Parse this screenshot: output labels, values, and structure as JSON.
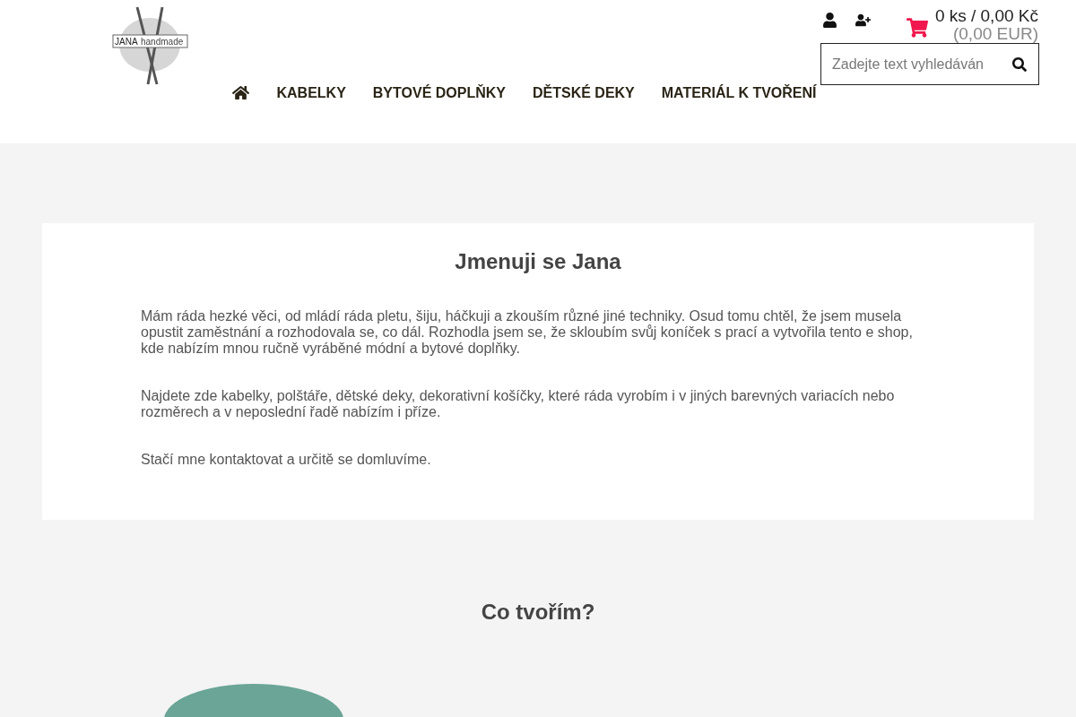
{
  "logo": {
    "name": "JANA",
    "suffix": "handmade"
  },
  "cart": {
    "summary": "0 ks / 0,00 Kč",
    "eur": "(0,00 EUR)"
  },
  "search": {
    "placeholder": "Zadejte text vyhledáván"
  },
  "nav": [
    {
      "kind": "home"
    },
    {
      "label": "KABELKY"
    },
    {
      "label": "BYTOVÉ DOPLŇKY"
    },
    {
      "label": "DĚTSKÉ DEKY"
    },
    {
      "label": "MATERIÁL K TVOŘENÍ"
    }
  ],
  "about": {
    "title": "Jmenuji se Jana",
    "paragraphs": [
      "Mám ráda hezké věci, od mládí ráda pletu, šiju, háčkuji a zkouším různé jiné techniky. Osud tomu chtěl, že jsem musela opustit zaměstnání a rozhodovala se, co dál. Rozhodla jsem se, že skloubím svůj koníček s prací a vytvořila tento e shop, kde nabízím mnou ručně vyráběné módní a bytové doplňky.",
      "Najdete zde kabelky, polštáře, dětské deky, dekorativní košíčky, které ráda vyrobím i v jiných barevných variacích nebo rozměrech a v neposlední řadě nabízím i příze.",
      "Stačí mne kontaktovat a určitě se domluvíme."
    ]
  },
  "section": {
    "title": "Co tvořím?"
  }
}
